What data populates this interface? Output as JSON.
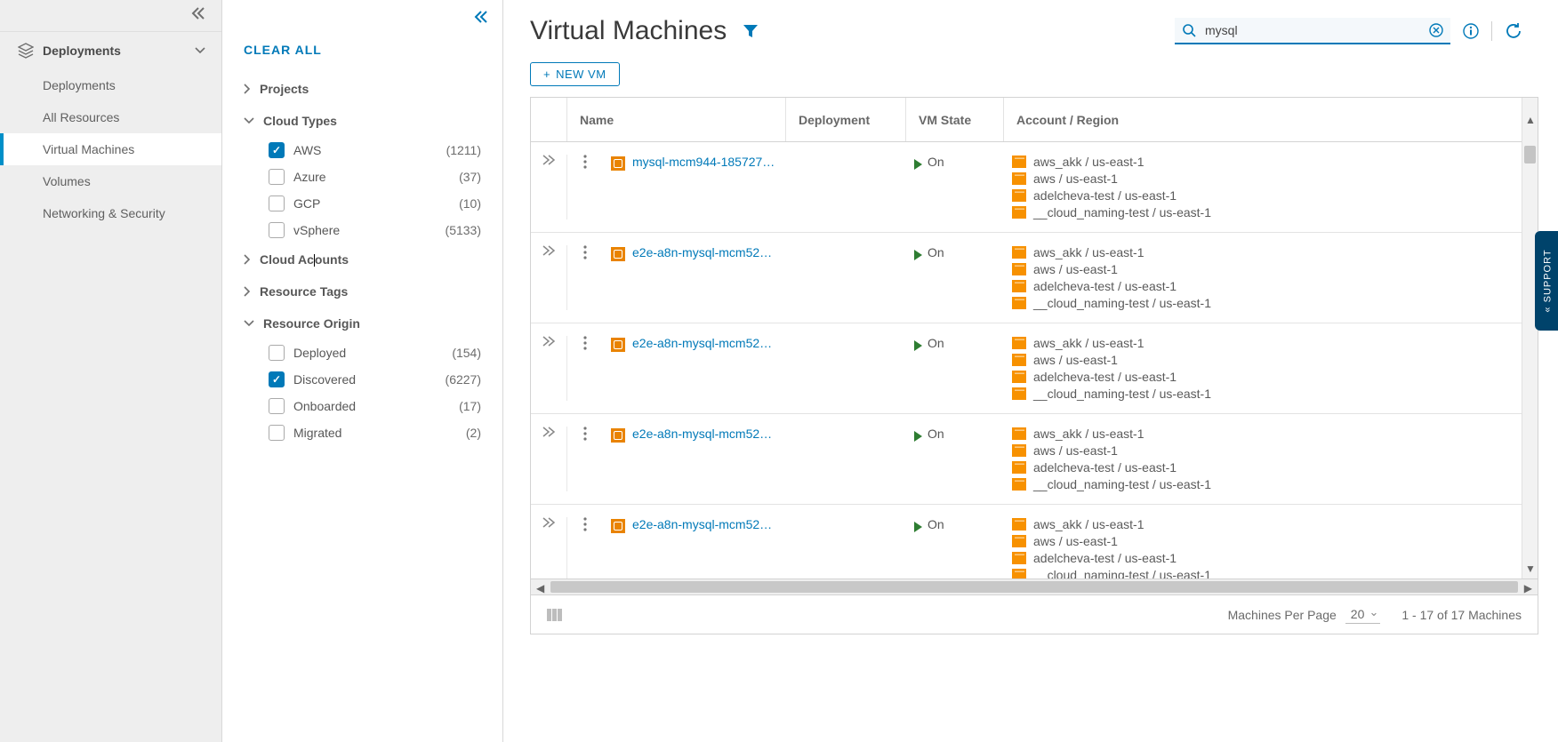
{
  "nav": {
    "section": "Deployments",
    "items": [
      "Deployments",
      "All Resources",
      "Virtual Machines",
      "Volumes",
      "Networking & Security"
    ],
    "active_index": 2
  },
  "filters": {
    "clear_all_label": "CLEAR ALL",
    "groups": {
      "projects": {
        "label": "Projects",
        "expanded": false
      },
      "cloud_types": {
        "label": "Cloud Types",
        "expanded": true,
        "items": [
          {
            "label": "AWS",
            "count": "(1211)",
            "checked": true
          },
          {
            "label": "Azure",
            "count": "(37)",
            "checked": false
          },
          {
            "label": "GCP",
            "count": "(10)",
            "checked": false
          },
          {
            "label": "vSphere",
            "count": "(5133)",
            "checked": false
          }
        ]
      },
      "cloud_accounts": {
        "label": "Cloud Accounts",
        "expanded": false
      },
      "resource_tags": {
        "label": "Resource Tags",
        "expanded": false
      },
      "resource_origin": {
        "label": "Resource Origin",
        "expanded": true,
        "items": [
          {
            "label": "Deployed",
            "count": "(154)",
            "checked": false
          },
          {
            "label": "Discovered",
            "count": "(6227)",
            "checked": true
          },
          {
            "label": "Onboarded",
            "count": "(17)",
            "checked": false
          },
          {
            "label": "Migrated",
            "count": "(2)",
            "checked": false
          }
        ]
      }
    }
  },
  "page": {
    "title": "Virtual Machines",
    "new_vm_label": "NEW VM"
  },
  "search": {
    "value": "mysql"
  },
  "grid": {
    "columns": {
      "name": "Name",
      "deployment": "Deployment",
      "vm_state": "VM State",
      "account_region": "Account / Region"
    },
    "state_on": "On",
    "accounts": [
      "aws_akk / us-east-1",
      "aws / us-east-1",
      "adelcheva-test / us-east-1",
      "__cloud_naming-test / us-east-1"
    ],
    "rows": [
      {
        "name": "mysql-mcm944-185727…"
      },
      {
        "name": "e2e-a8n-mysql-mcm52…"
      },
      {
        "name": "e2e-a8n-mysql-mcm52…"
      },
      {
        "name": "e2e-a8n-mysql-mcm52…"
      },
      {
        "name": "e2e-a8n-mysql-mcm52…"
      }
    ],
    "footer": {
      "per_page_label": "Machines Per Page",
      "per_page_value": "20",
      "range_label": "1 - 17 of 17 Machines"
    }
  },
  "support_label": "SUPPORT"
}
